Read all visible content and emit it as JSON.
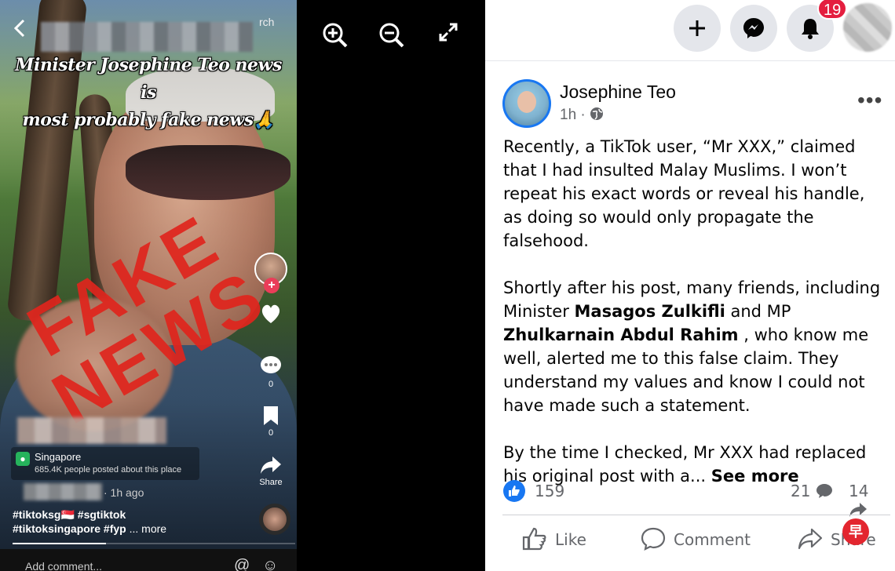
{
  "tiktok": {
    "search_partial": "rch",
    "headline_line1": "Minister Josephine Teo news is",
    "headline_line2": "most probably fake news",
    "headline_emoji": "🙏",
    "stamp_line1": "FAKE",
    "stamp_line2": "NEWS",
    "comment_count": "0",
    "bookmark_count": "0",
    "share_label": "Share",
    "location_name": "Singapore",
    "location_sub": "685.4K people posted about this place",
    "time_ago": "· 1h ago",
    "hashtags_line1": "#tiktoksg",
    "hashtags_flag": "🇸🇬",
    "hashtags_line1b": " #sgtiktok",
    "hashtags_line2": "#tiktoksingapore #fyp",
    "more_label": "... more",
    "comment_placeholder": "Add comment...",
    "progress": 0.33
  },
  "viewer": {
    "icons": [
      "zoom-in-icon",
      "zoom-out-icon",
      "fullscreen-icon"
    ]
  },
  "facebook": {
    "notification_count": "19",
    "author": "Josephine Teo",
    "time": "1h ·",
    "post": {
      "p1": "Recently, a TikTok user, “Mr XXX,” claimed that I had insulted Malay Muslims. I won’t repeat his exact words or reveal his handle, as doing so would only propagate the falsehood.",
      "p2_a": "Shortly after his post, many friends, including Minister ",
      "p2_name1": "Masagos Zulkifli",
      "p2_b": " and MP ",
      "p2_name2": "Zhulkarnain Abdul Rahim",
      "p2_c": " , who know me well, alerted me to this false claim. They understand my values and know I could not have made such a statement.",
      "p3": "By the time I checked, Mr XXX had replaced his original post with a...",
      "see_more": "See more"
    },
    "likes": "159",
    "comments": "21",
    "shares": "14",
    "actions": {
      "like": "Like",
      "comment": "Comment",
      "share": "Share"
    },
    "brand_color": "#1877f2",
    "watermark": "早"
  }
}
